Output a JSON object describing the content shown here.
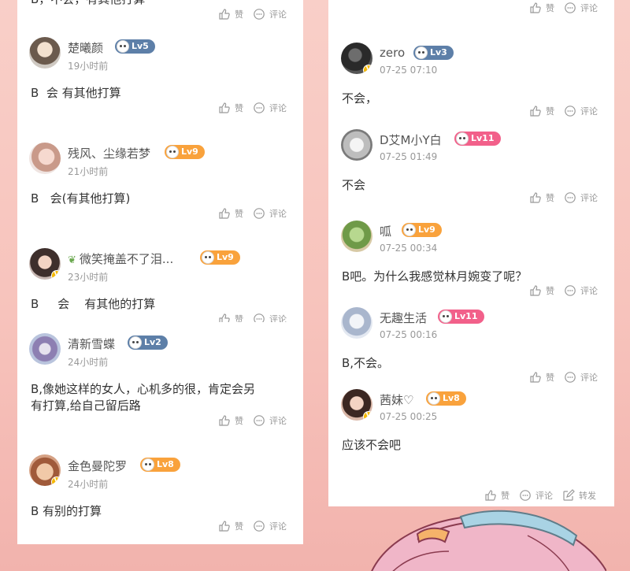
{
  "actions": {
    "like": "赞",
    "comment": "评论",
    "share": "转发"
  },
  "left_column": [
    {
      "username": "",
      "time": "",
      "content": "B，不会，有其他打算"
    },
    {
      "username": "楚曦颜",
      "level": "Lv5",
      "time": "19小时前",
      "content": "B  会 有其他打算"
    },
    {
      "username": "残风、尘缘若梦",
      "level": "Lv9",
      "time": "21小时前",
      "content": "B   会(有其他打算)"
    },
    {
      "username": "微笑掩盖不了泪...",
      "level": "Lv9",
      "time": "23小时前",
      "content": "B     会    有其他的打算"
    },
    {
      "username": "清新雪蝶",
      "level": "Lv2",
      "time": "24小时前",
      "content": "B,像她这样的女人，心机多的很，肯定会另\n有打算,给自己留后路"
    },
    {
      "username": "金色曼陀罗",
      "level": "Lv8",
      "time": "24小时前",
      "content": "B 有别的打算"
    }
  ],
  "right_column": [
    {
      "username": "zero",
      "level": "Lv3",
      "time": "07-25 07:10",
      "content": "不会，"
    },
    {
      "username": "D艾M小Y白",
      "level": "Lv11",
      "time": "07-25 01:49",
      "content": "不会"
    },
    {
      "username": "呱",
      "level": "Lv9",
      "time": "07-25 00:34",
      "content": "B吧。为什么我感觉林月婉变了呢？"
    },
    {
      "username": "无趣生活",
      "level": "Lv11",
      "time": "07-25 00:16",
      "content": "B,不会。"
    },
    {
      "username": "茜妹♡",
      "level": "Lv8",
      "time": "07-25 00:25",
      "content": "应该不会吧"
    }
  ],
  "colors": {
    "background": "#f8c9c2",
    "level_blue": "#5d7fa8",
    "level_orange": "#f9a23c",
    "level_pink": "#f2608a",
    "vip_badge": "#f5b800"
  },
  "icons": [
    "thumbs-up-icon",
    "comment-icon",
    "share-icon",
    "vip-badge-icon",
    "level-face-icon"
  ]
}
